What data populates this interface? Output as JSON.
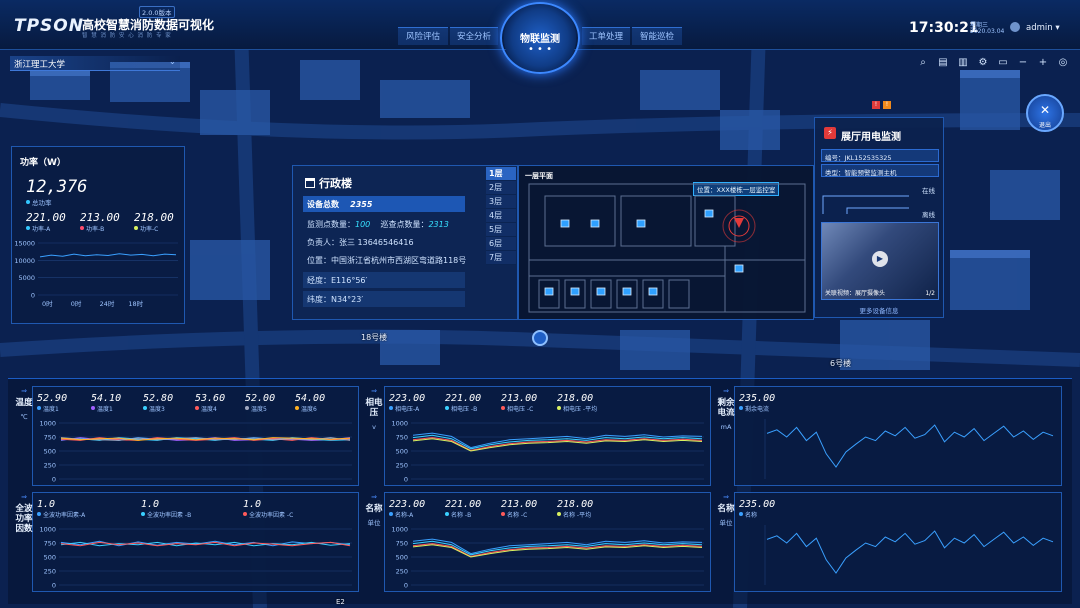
{
  "header": {
    "brand": "TPSON",
    "system_name": "高校智慧消防数据可视化",
    "version": "2.0.0版本",
    "slogan": "智 慧 消 防 安 心 消 防 专 家",
    "nav_left": [
      "风险评估",
      "安全分析"
    ],
    "nav_center": "物联监测",
    "nav_center_dots": "• • •",
    "nav_right": [
      "工单处理",
      "智能巡检"
    ],
    "time": "17:30:21",
    "weekday": "星期三",
    "date": "2020.03.04",
    "user": "admin ▾"
  },
  "toolbar": {
    "campus": "浙江理工大学",
    "tools": [
      "search-icon",
      "zoom-fit-icon",
      "building-icon",
      "gear-icon",
      "monitor-icon",
      "minus-icon",
      "plus-icon",
      "locate-icon"
    ],
    "exit_label": "退出"
  },
  "map_labels": {
    "building_18": "18号楼",
    "building_6": "6号楼",
    "bottom_1": "E2"
  },
  "power_panel": {
    "title": "功率（W）",
    "total_value": "12,376",
    "total_label": "总功率",
    "phases": [
      {
        "value": "221.00",
        "label": "功率-A",
        "color": "#33c7ff"
      },
      {
        "value": "213.00",
        "label": "功率-B",
        "color": "#ff4d6d"
      },
      {
        "value": "218.00",
        "label": "功率-C",
        "color": "#d8f060"
      }
    ],
    "y_ticks": [
      "15000",
      "10000",
      "5000",
      "0"
    ],
    "x_ticks": [
      "0时",
      "0时",
      "24时",
      "18时"
    ]
  },
  "building": {
    "title": "行政楼",
    "device_total_label": "设备总数",
    "device_total": "2355",
    "monitor_label": "监测点数量：",
    "monitor_count": "100",
    "patrol_label": "巡查点数量：",
    "patrol_count": "2313",
    "owner": "负责人：张三   13646546416",
    "address": "位置：中国浙江省杭州市西湖区弯道路118号",
    "longitude": "经度：E116°56′",
    "latitude": "纬度：N34°23′",
    "floors": [
      "1层",
      "2层",
      "3层",
      "4层",
      "5层",
      "6层",
      "7层"
    ],
    "active_floor": 0,
    "floorplan_title": "一层平面",
    "location_pill": "位置：XXX楼栋一层监控室"
  },
  "hall": {
    "title": "展厅用电监测",
    "code": "编号：JKL152535325",
    "type": "类型：智能预警监测主机",
    "status_online": "在线",
    "status_offline": "离线",
    "video_caption": "关联视频：展厅摄像头",
    "video_page": "1/2",
    "more": "更多设备信息"
  },
  "cards": {
    "temperature": {
      "side": "温度",
      "unit": "℃",
      "stats": [
        {
          "value": "52.90",
          "label": "温度1",
          "color": "#3aa0ff"
        },
        {
          "value": "54.10",
          "label": "温度1",
          "color": "#a060ff"
        },
        {
          "value": "52.80",
          "label": "温度3",
          "color": "#3ad0ff"
        },
        {
          "value": "53.60",
          "label": "温度4",
          "color": "#ff5a5a"
        },
        {
          "value": "52.00",
          "label": "温度5",
          "color": "#a0a8c0"
        },
        {
          "value": "54.00",
          "label": "温度6",
          "color": "#ffb020"
        }
      ],
      "y_ticks": [
        "1000",
        "750",
        "500",
        "250",
        "0"
      ]
    },
    "phase_voltage": {
      "side": "相电压",
      "unit": "v",
      "stats": [
        {
          "value": "223.00",
          "label": "相电压-A",
          "color": "#3aa0ff"
        },
        {
          "value": "221.00",
          "label": "相电压 -B",
          "color": "#3ad0ff"
        },
        {
          "value": "213.00",
          "label": "相电压 -C",
          "color": "#ff5a5a"
        },
        {
          "value": "218.00",
          "label": "相电压 -平均",
          "color": "#d8f060"
        }
      ],
      "y_ticks": [
        "1000",
        "750",
        "500",
        "250",
        "0"
      ]
    },
    "residual_current": {
      "side": "剩余电流",
      "unit": "mA",
      "stats": [
        {
          "value": "235.00",
          "label": "剩余电流",
          "color": "#3aa0ff"
        }
      ]
    },
    "power_factor": {
      "side": "全波功率因数",
      "unit": "",
      "stats": [
        {
          "value": "1.0",
          "label": "全波功率因素-A",
          "color": "#3aa0ff"
        },
        {
          "value": "1.0",
          "label": "全波功率因素 -B",
          "color": "#3ad0ff"
        },
        {
          "value": "1.0",
          "label": "全波功率因素 -C",
          "color": "#ff5a5a"
        }
      ],
      "y_ticks": [
        "1000",
        "750",
        "500",
        "250",
        "0"
      ]
    },
    "name_a": {
      "side": "名称",
      "unit": "单位",
      "stats": [
        {
          "value": "223.00",
          "label": "名称-A",
          "color": "#3aa0ff"
        },
        {
          "value": "221.00",
          "label": "名称 -B",
          "color": "#3ad0ff"
        },
        {
          "value": "213.00",
          "label": "名称 -C",
          "color": "#ff5a5a"
        },
        {
          "value": "218.00",
          "label": "名称 -平均",
          "color": "#d8f060"
        }
      ],
      "y_ticks": [
        "1000",
        "750",
        "500",
        "250",
        "0"
      ]
    },
    "name_b": {
      "side": "名称",
      "unit": "单位",
      "stats": [
        {
          "value": "235.00",
          "label": "名称",
          "color": "#3aa0ff"
        }
      ]
    }
  },
  "chart_data": [
    {
      "type": "line",
      "title": "功率（W）",
      "ylim": [
        0,
        15000
      ],
      "y_ticks": [
        0,
        5000,
        10000,
        15000
      ],
      "x": [
        "0时",
        "0时",
        "24时",
        "18时"
      ],
      "series": [
        {
          "values": [
            11000,
            11500,
            11200,
            11800,
            11300,
            11600,
            11400,
            11900,
            11500,
            11700,
            11300,
            11800,
            11600
          ]
        }
      ]
    },
    {
      "type": "line",
      "ylim": [
        0,
        1000
      ],
      "y_ticks": [
        0,
        250,
        500,
        750,
        1000
      ],
      "series": [
        {
          "name": "温度1",
          "values": [
            720,
            700,
            730,
            690,
            740,
            710,
            700,
            730,
            720,
            700,
            740,
            710,
            700,
            730,
            720,
            710
          ]
        },
        {
          "name": "温度1",
          "values": [
            690,
            740,
            700,
            720,
            700,
            730,
            690,
            700,
            740,
            690,
            700,
            730,
            710,
            690,
            700,
            740
          ]
        },
        {
          "name": "温度3",
          "values": [
            700,
            720,
            690,
            740,
            710,
            690,
            740,
            720,
            690,
            730,
            710,
            690,
            740,
            710,
            690,
            700
          ]
        },
        {
          "name": "温度4",
          "values": [
            710,
            690,
            740,
            700,
            690,
            740,
            710,
            690,
            710,
            740,
            690,
            720,
            690,
            740,
            700,
            720
          ]
        },
        {
          "name": "温度5",
          "values": [
            740,
            710,
            700,
            690,
            730,
            700,
            720,
            740,
            700,
            710,
            730,
            700,
            720,
            700,
            740,
            690
          ]
        },
        {
          "name": "温度6",
          "values": [
            730,
            700,
            720,
            730,
            690,
            720,
            730,
            700,
            730,
            720,
            700,
            740,
            730,
            720,
            710,
            730
          ]
        }
      ]
    },
    {
      "type": "line",
      "ylim": [
        0,
        1000
      ],
      "y_ticks": [
        0,
        250,
        500,
        750,
        1000
      ],
      "series": [
        {
          "name": "相电压-A",
          "values": [
            780,
            820,
            760,
            560,
            640,
            700,
            720,
            740,
            760,
            720,
            780,
            760,
            790,
            750,
            770,
            760
          ]
        },
        {
          "name": "相电压 -B",
          "values": [
            740,
            780,
            720,
            540,
            610,
            660,
            690,
            700,
            720,
            690,
            740,
            720,
            750,
            720,
            740,
            720
          ]
        },
        {
          "name": "相电压 -C",
          "values": [
            700,
            740,
            690,
            510,
            580,
            630,
            660,
            670,
            690,
            660,
            700,
            690,
            720,
            690,
            710,
            690
          ]
        },
        {
          "name": "相电压 -平均",
          "values": [
            680,
            720,
            670,
            500,
            560,
            610,
            640,
            650,
            670,
            640,
            680,
            670,
            700,
            670,
            690,
            670
          ]
        }
      ]
    },
    {
      "type": "line",
      "ylim": [
        0,
        1000
      ],
      "series": [
        {
          "name": "剩余电流",
          "values": [
            760,
            820,
            700,
            860,
            640,
            780,
            420,
            200,
            450,
            580,
            700,
            640,
            800,
            720,
            860,
            680,
            740,
            900,
            620,
            780,
            700,
            840,
            640,
            760,
            880,
            700,
            800,
            660,
            780,
            720
          ]
        }
      ]
    },
    {
      "type": "line",
      "ylim": [
        0,
        1000
      ],
      "y_ticks": [
        0,
        250,
        500,
        750,
        1000
      ],
      "series": [
        {
          "name": "全波功率因素-A",
          "values": [
            760,
            720,
            780,
            700,
            770,
            710,
            760,
            730,
            780,
            720,
            760,
            700,
            770,
            740,
            760,
            720
          ]
        },
        {
          "name": "全波功率因素 -B",
          "values": [
            720,
            760,
            700,
            740,
            720,
            760,
            700,
            750,
            720,
            760,
            700,
            740,
            720,
            760,
            710,
            740
          ]
        },
        {
          "name": "全波功率因素 -C",
          "values": [
            740,
            700,
            760,
            720,
            750,
            700,
            740,
            720,
            760,
            700,
            750,
            730,
            700,
            740,
            760,
            700
          ]
        }
      ]
    },
    {
      "type": "line",
      "ylim": [
        0,
        1000
      ],
      "y_ticks": [
        0,
        250,
        500,
        750,
        1000
      ],
      "series": [
        {
          "name": "名称-A",
          "values": [
            780,
            820,
            760,
            560,
            640,
            700,
            720,
            740,
            760,
            720,
            780,
            760,
            790,
            750,
            770,
            760
          ]
        },
        {
          "name": "名称 -B",
          "values": [
            740,
            780,
            720,
            540,
            610,
            660,
            690,
            700,
            720,
            690,
            740,
            720,
            750,
            720,
            740,
            720
          ]
        },
        {
          "name": "名称 -C",
          "values": [
            700,
            740,
            690,
            510,
            580,
            630,
            660,
            670,
            690,
            660,
            700,
            690,
            720,
            690,
            710,
            690
          ]
        },
        {
          "name": "名称 -平均",
          "values": [
            680,
            720,
            670,
            500,
            560,
            610,
            640,
            650,
            670,
            640,
            680,
            670,
            700,
            670,
            690,
            670
          ]
        }
      ]
    },
    {
      "type": "line",
      "ylim": [
        0,
        1000
      ],
      "series": [
        {
          "name": "名称",
          "values": [
            760,
            820,
            700,
            860,
            640,
            780,
            420,
            200,
            450,
            580,
            700,
            640,
            800,
            720,
            860,
            680,
            740,
            900,
            620,
            780,
            700,
            840,
            640,
            760,
            880,
            700,
            800,
            660,
            780,
            720
          ]
        }
      ]
    }
  ]
}
